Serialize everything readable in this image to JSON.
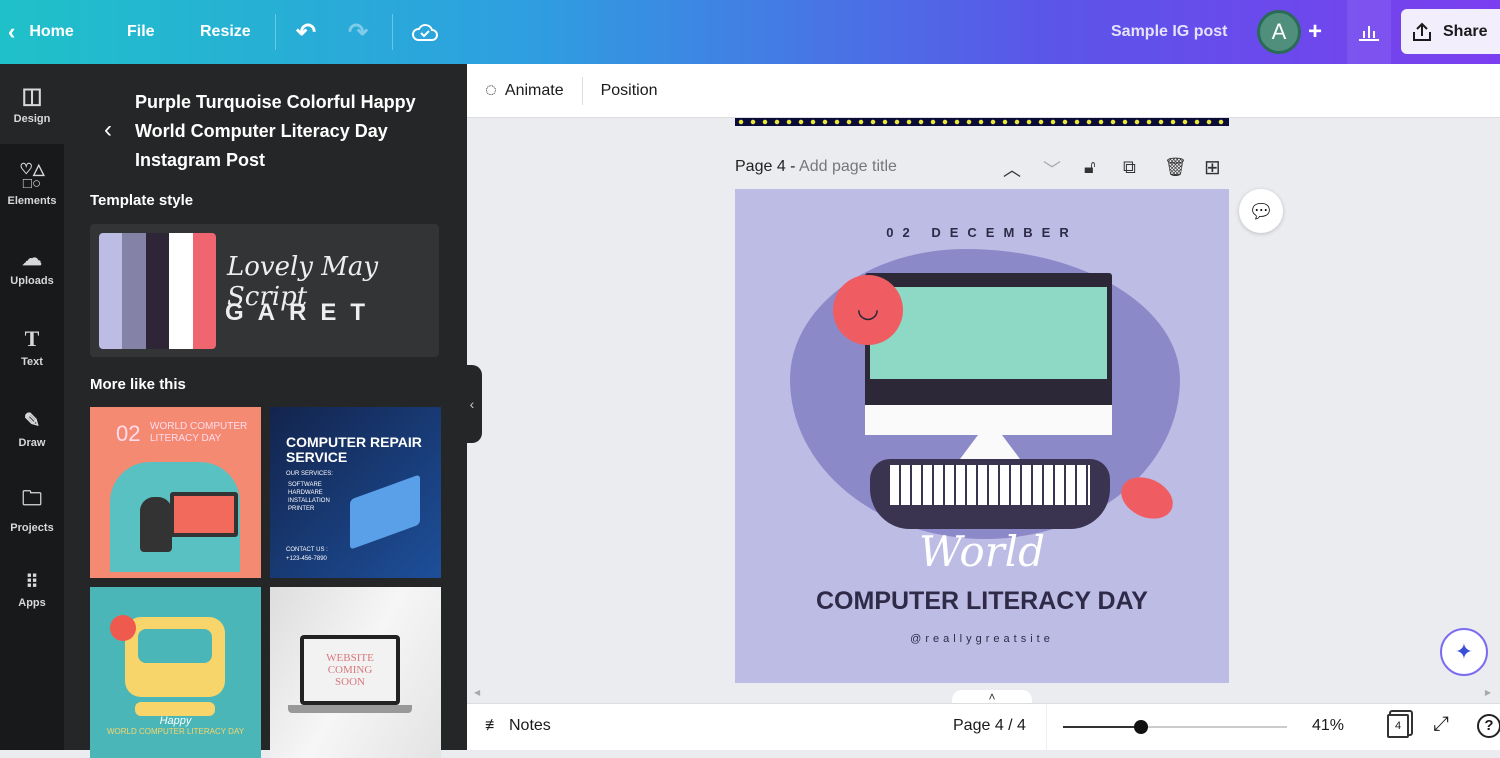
{
  "topbar": {
    "home": "Home",
    "file": "File",
    "resize": "Resize",
    "design_name": "Sample IG post",
    "avatar_initial": "A",
    "share": "Share",
    "gradient_start": "#1fc1c9",
    "gradient_end": "#7b3ef0"
  },
  "rail": [
    {
      "label": "Design",
      "icon": "layout-icon"
    },
    {
      "label": "Elements",
      "icon": "shapes-icon"
    },
    {
      "label": "Uploads",
      "icon": "cloud-upload-icon"
    },
    {
      "label": "Text",
      "icon": "text-icon"
    },
    {
      "label": "Draw",
      "icon": "draw-icon"
    },
    {
      "label": "Projects",
      "icon": "folder-icon"
    },
    {
      "label": "Apps",
      "icon": "apps-grid-icon"
    }
  ],
  "panel": {
    "title": "Purple Turquoise Colorful Happy World Computer Literacy Day Instagram Post",
    "template_style": "Template style",
    "palette": [
      "#bdbce5",
      "#8582a8",
      "#2e2536",
      "#ffffff",
      "#ef6670"
    ],
    "font_script": "Lovely May Script",
    "font_heading": "GARET",
    "more_like_this": "More like this",
    "thumbs": [
      {
        "num": "02",
        "text": "WORLD COMPUTER LITERACY DAY"
      },
      {
        "title": "COMPUTER REPAIR SERVICE",
        "subtitle": "OUR SERVICES:",
        "items": [
          "SOFTWARE",
          "HARDWARE",
          "INSTALLATION",
          "PRINTER"
        ],
        "contact": "CONTACT US :",
        "phone": "+123-456-7890"
      },
      {
        "script": "Happy",
        "text": "WORLD COMPUTER LITERACY DAY"
      },
      {
        "text": "WEBSITE COMING SOON"
      }
    ]
  },
  "toolbar": {
    "animate": "Animate",
    "position": "Position"
  },
  "page_header": {
    "label": "Page 4 -",
    "placeholder": "Add page title"
  },
  "design": {
    "date": "02 DECEMBER",
    "script": "World",
    "heading": "COMPUTER LITERACY DAY",
    "handle": "@reallygreatsite",
    "bg": "#bdbce5"
  },
  "bottombar": {
    "notes": "Notes",
    "page_indicator": "Page 4 / 4",
    "zoom": "41%",
    "zoom_fraction": 0.35,
    "page_count": "4"
  }
}
